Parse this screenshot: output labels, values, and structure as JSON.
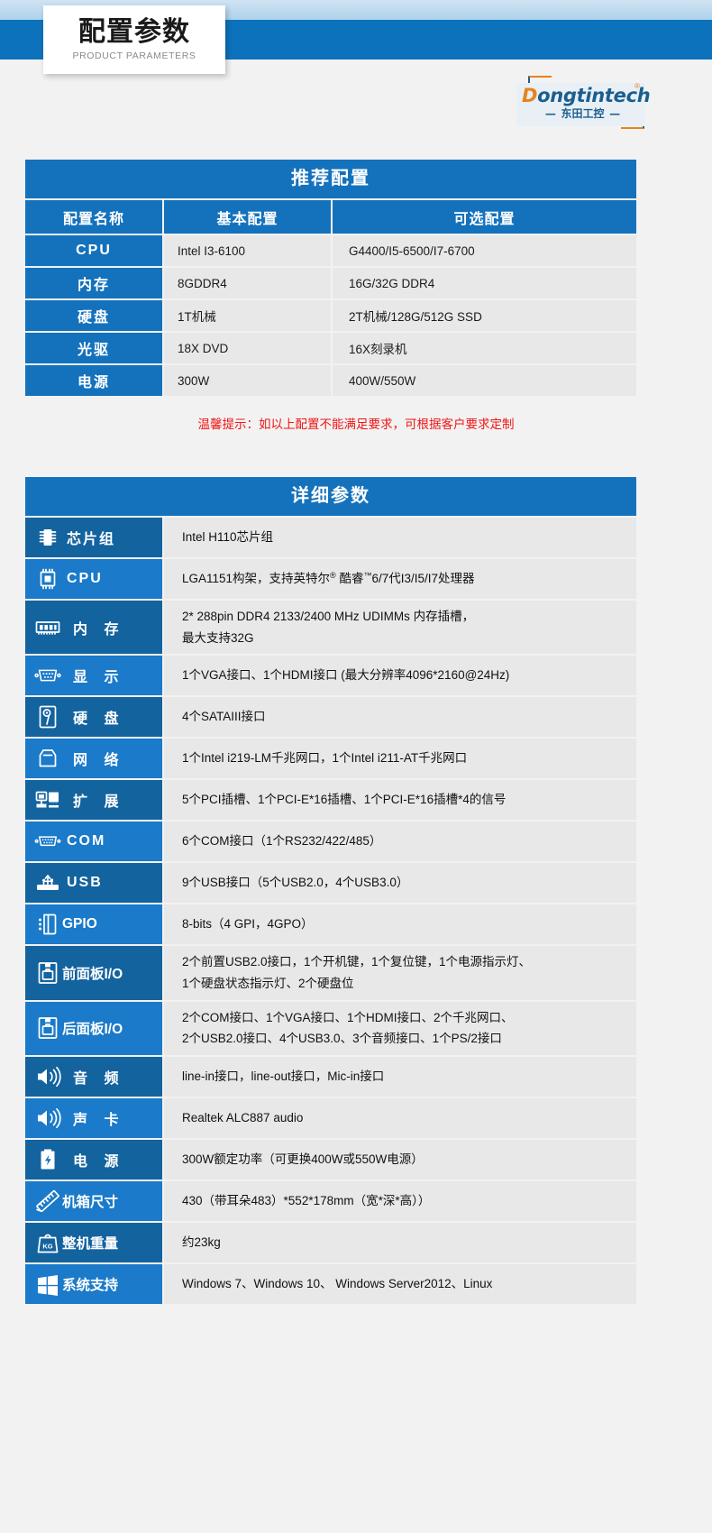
{
  "banner": {
    "title_cn": "配置参数",
    "title_en": "PRODUCT PARAMETERS"
  },
  "logo": {
    "brand_first": "D",
    "brand_rest": "ongtintech",
    "registered": "®",
    "brand_cn": "东田工控",
    "dash_left": "—",
    "dash_right": "—"
  },
  "recommended": {
    "section_title": "推荐配置",
    "columns": [
      "配置名称",
      "基本配置",
      "可选配置"
    ],
    "rows": [
      {
        "name": "CPU",
        "basic": "Intel I3-6100",
        "optional": "G4400/I5-6500/I7-6700"
      },
      {
        "name": "内存",
        "basic": "8GDDR4",
        "optional": "16G/32G DDR4"
      },
      {
        "name": "硬盘",
        "basic": "1T机械",
        "optional": "2T机械/128G/512G SSD"
      },
      {
        "name": "光驱",
        "basic": "18X DVD",
        "optional": "16X刻录机"
      },
      {
        "name": "电源",
        "basic": "300W",
        "optional": "400W/550W"
      }
    ],
    "notice": "温馨提示：如以上配置不能满足要求，可根据客户要求定制"
  },
  "details": {
    "section_title": "详细参数",
    "rows": [
      {
        "icon": "chip-icon",
        "label": "芯片组",
        "lines": [
          "Intel H110芯片组"
        ]
      },
      {
        "icon": "cpu-icon",
        "label": "CPU",
        "lines": [
          "LGA1151构架，支持英特尔® 酷睿™6/7代I3/I5/I7处理器"
        ]
      },
      {
        "icon": "memory-icon",
        "label": "内 存",
        "lines": [
          "2* 288pin DDR4 2133/2400 MHz UDIMMs 内存插槽，",
          "最大支持32G"
        ]
      },
      {
        "icon": "display-port-icon",
        "label": "显 示",
        "lines": [
          "1个VGA接口、1个HDMI接口 (最大分辨率4096*2160@24Hz)"
        ]
      },
      {
        "icon": "harddisk-icon",
        "label": "硬 盘",
        "lines": [
          "4个SATAIII接口"
        ]
      },
      {
        "icon": "network-icon",
        "label": "网 络",
        "lines": [
          "1个Intel  i219-LM千兆网口，1个Intel i211-AT千兆网口"
        ]
      },
      {
        "icon": "expansion-icon",
        "label": "扩 展",
        "lines": [
          "5个PCI插槽、1个PCI-E*16插槽、1个PCI-E*16插槽*4的信号"
        ]
      },
      {
        "icon": "serial-port-icon",
        "label": "COM",
        "lines": [
          "6个COM接口（1个RS232/422/485）"
        ]
      },
      {
        "icon": "usb-icon",
        "label": "USB",
        "lines": [
          "9个USB接口（5个USB2.0，4个USB3.0）"
        ]
      },
      {
        "icon": "gpio-icon",
        "label": "GPIO",
        "lines": [
          "8-bits（4 GPI，4GPO）"
        ]
      },
      {
        "icon": "front-panel-icon",
        "label": "前面板I/O",
        "lines": [
          "2个前置USB2.0接口，1个开机键，1个复位键，1个电源指示灯、",
          "1个硬盘状态指示灯、2个硬盘位"
        ]
      },
      {
        "icon": "rear-panel-icon",
        "label": "后面板I/O",
        "lines": [
          "2个COM接口、1个VGA接口、1个HDMI接口、2个千兆网口、",
          "2个USB2.0接口、4个USB3.0、3个音频接口、1个PS/2接口"
        ]
      },
      {
        "icon": "speaker-icon",
        "label": "音 频",
        "lines": [
          "line-in接口，line-out接口，Mic-in接口"
        ]
      },
      {
        "icon": "speaker-icon",
        "label": "声 卡",
        "lines": [
          "Realtek  ALC887 audio"
        ]
      },
      {
        "icon": "power-icon",
        "label": "电 源",
        "lines": [
          "300W额定功率（可更换400W或550W电源）"
        ]
      },
      {
        "icon": "ruler-icon",
        "label": "机箱尺寸",
        "lines": [
          "430（带耳朵483）*552*178mm（宽*深*高））"
        ]
      },
      {
        "icon": "weight-icon",
        "label": "整机重量",
        "lines": [
          "约23kg"
        ]
      },
      {
        "icon": "windows-icon",
        "label": "系统支持",
        "lines": [
          "Windows 7、Windows 10、 Windows Server2012、Linux"
        ]
      }
    ]
  },
  "colors": {
    "brand_blue": "#1472bd",
    "dark_blue": "#13639f",
    "light_blue": "#1b7ac9",
    "cell_gray": "#e8e8e8",
    "notice_red": "#f01414",
    "logo_orange": "#e8821e",
    "logo_blue": "#1b5e8f"
  }
}
